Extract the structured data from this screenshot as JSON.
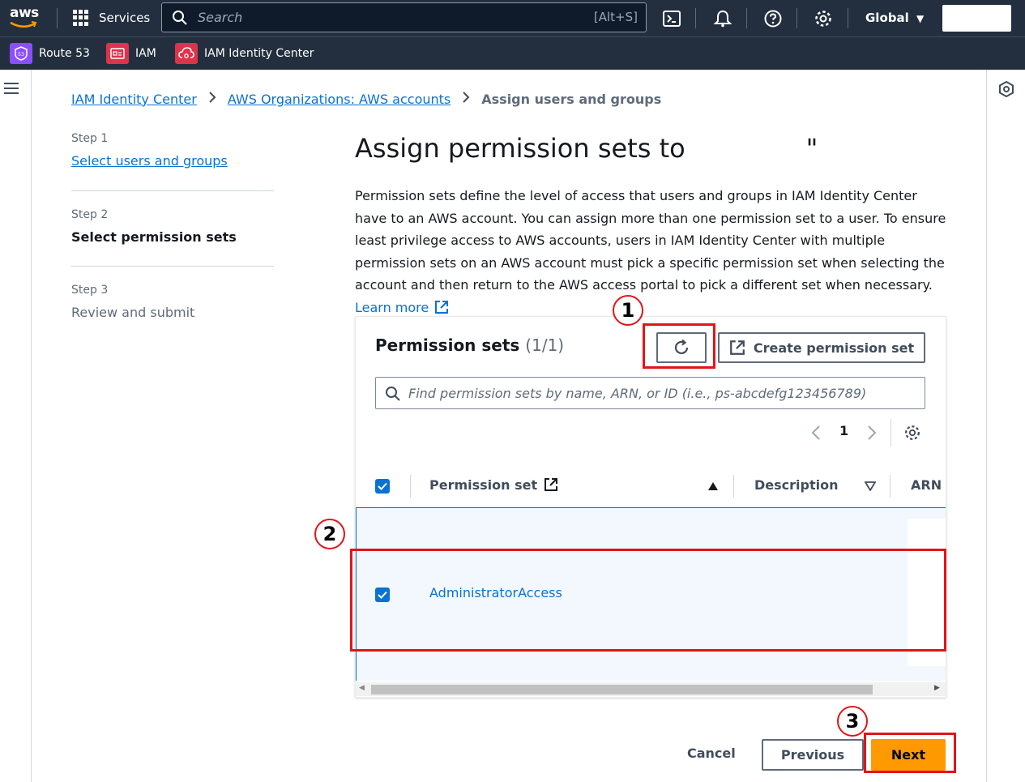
{
  "topnav": {
    "logo": "aws",
    "services": "Services",
    "search_placeholder": "Search",
    "search_shortcut": "[Alt+S]",
    "region": "Global"
  },
  "favorites": [
    {
      "label": "Route 53",
      "color": "#8c4fff"
    },
    {
      "label": "IAM",
      "color": "#dd344c"
    },
    {
      "label": "IAM Identity Center",
      "color": "#dd344c"
    }
  ],
  "breadcrumb": {
    "items": [
      "IAM Identity Center",
      "AWS Organizations: AWS accounts"
    ],
    "current": "Assign users and groups"
  },
  "steps": [
    {
      "label": "Step 1",
      "title": "Select users and groups"
    },
    {
      "label": "Step 2",
      "title": "Select permission sets"
    },
    {
      "label": "Step 3",
      "title": "Review and submit"
    }
  ],
  "page": {
    "title": "Assign permission sets to \"",
    "title_end": "\"",
    "description": "Permission sets define the level of access that users and groups in IAM Identity Center have to an AWS account. You can assign more than one permission set to a user. To ensure least privilege access to AWS accounts, users in IAM Identity Center with multiple permission sets on an AWS account must pick a specific permission set when selecting the account and then return to the AWS access portal to pick a different set when necessary.",
    "learn_more": "Learn more"
  },
  "permission_sets": {
    "title": "Permission sets",
    "count": "(1/1)",
    "create_label": "Create permission set",
    "find_placeholder": "Find permission sets by name, ARN, or ID (i.e., ps-abcdefg123456789)",
    "page_number": "1",
    "columns": [
      "Permission set",
      "Description",
      "ARN"
    ],
    "rows": [
      {
        "name": "AdministratorAccess",
        "selected": true
      }
    ]
  },
  "footer": {
    "cancel": "Cancel",
    "previous": "Previous",
    "next": "Next"
  },
  "annotations": [
    "1",
    "2",
    "3"
  ],
  "colors": {
    "accent": "#0972d3",
    "primary_button": "#ff9900",
    "highlight": "#e0151a"
  }
}
